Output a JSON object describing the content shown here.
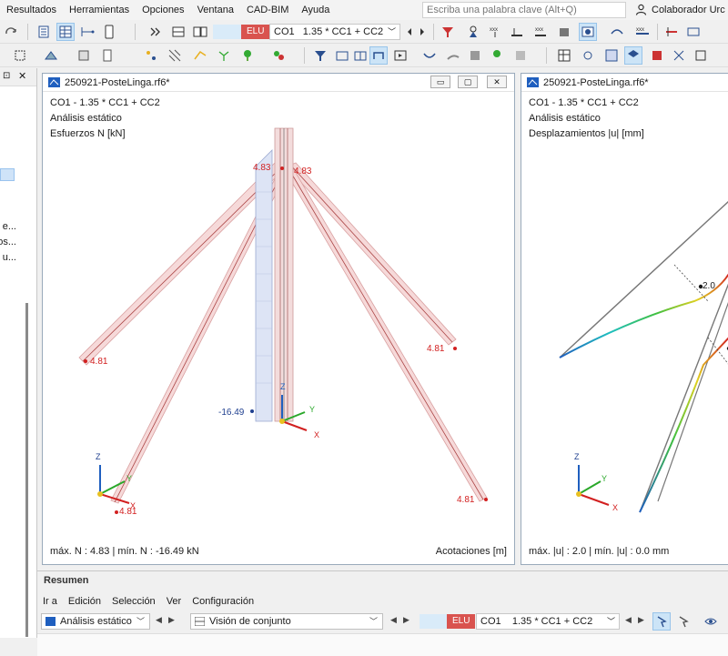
{
  "menu": {
    "items": [
      "Resultados",
      "Herramientas",
      "Opciones",
      "Ventana",
      "CAD-BIM",
      "Ayuda"
    ],
    "search_placeholder": "Escriba una palabra clave (Alt+Q)",
    "user": "Colaborador Urc"
  },
  "toolbar": {
    "elu": "ELU",
    "load_combo_id": "CO1",
    "load_combo_formula": "1.35 * CC1 + CC2"
  },
  "left_panel": {
    "lines": [
      "e...",
      "os...",
      "u..."
    ]
  },
  "window1": {
    "title": "250921-PosteLinga.rf6*",
    "info": [
      "CO1 - 1.35 * CC1 + CC2",
      "Análisis estático",
      "Esfuerzos N [kN]"
    ],
    "footer_left": "máx. N : 4.83 | mín. N : -16.49 kN",
    "footer_right": "Acotaciones [m]",
    "labels": {
      "top_left": "4.83",
      "top_right": "4.83",
      "left_end": "4.81",
      "right_end": "4.81",
      "bottom_left": "4.81",
      "bottom_right": "4.81",
      "mast_base": "-16.49"
    }
  },
  "window2": {
    "title": "250921-PosteLinga.rf6*",
    "info": [
      "CO1 - 1.35 * CC1 + CC2",
      "Análisis estático",
      "Desplazamientos |u| [mm]"
    ],
    "footer_left": "máx. |u| : 2.0 | mín. |u| : 0.0 mm",
    "label_2": "2.0"
  },
  "axes": {
    "x": "X",
    "y": "Y",
    "z": "Z"
  },
  "resumen": {
    "title": "Resumen",
    "menu": [
      "Ir a",
      "Edición",
      "Selección",
      "Ver",
      "Configuración"
    ],
    "analysis": "Análisis estático",
    "view": "Visión de conjunto",
    "elu": "ELU",
    "co": "CO1",
    "formula": "1.35 * CC1 + CC2"
  },
  "colors": {
    "accent_blue": "#1f5fbf",
    "elu_red": "#d9534f",
    "force_red": "#d22020",
    "member_fill": "#f3c9c9"
  }
}
